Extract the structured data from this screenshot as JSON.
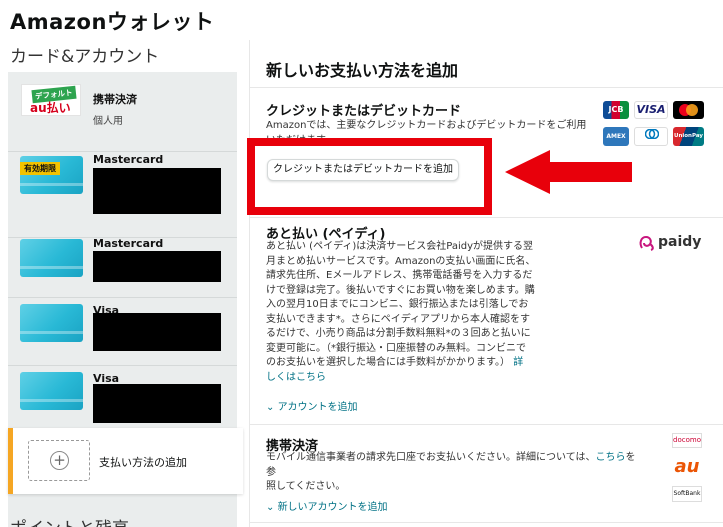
{
  "header": {
    "title": "Amazonウォレット",
    "section": "カード&アカウント",
    "bottom": "ポイントと残高"
  },
  "left": {
    "items": [
      {
        "name": "携帯決済",
        "sub": "個人用",
        "tag": "デフォルト",
        "logo": "au払い"
      },
      {
        "name": "Mastercard",
        "badge": "有効期限"
      },
      {
        "name": "Mastercard"
      },
      {
        "name": "Visa"
      },
      {
        "name": "Visa"
      }
    ],
    "add_label": "支払い方法の追加"
  },
  "panel": {
    "title": "新しいお支払い方法を追加",
    "credit": {
      "heading": "クレジットまたはデビットカード",
      "desc": "Amazonでは、主要なクレジットカードおよびデビットカードをご利用いただけます。",
      "button": "クレジットまたはデビットカードを追加",
      "logos": [
        "JCB",
        "VISA",
        "Mastercard",
        "AMEX",
        "Diners Club",
        "UnionPay"
      ]
    },
    "paidy": {
      "heading": "あと払い (ペイディ)",
      "logo": "paidy",
      "desc_lines": [
        "あと払い (ペイディ)は決済サービス会社Paidyが提供する翌",
        "月まとめ払いサービスです。Amazonの支払い画面に氏名、",
        "請求先住所、Eメールアドレス、携帯電話番号を入力するだ",
        "けで登録は完了。後払いですぐにお買い物を楽しめます。購",
        "入の翌月10日までにコンビニ、銀行振込または引落しでお",
        "支払いできます*。さらにペイディアプリから本人確認をす",
        "るだけで、小売り商品は分割手数料無料*の３回あと払いに",
        "変更可能に。（*銀行振込・口座振替のみ無料。コンビニで",
        "のお支払いを選択した場合には手数料がかかります。）"
      ],
      "detail_link": "詳",
      "detail_link2": "しくはこちら",
      "expand": "アカウントを追加"
    },
    "carrier": {
      "heading": "携帯決済",
      "desc1": "モバイル通信事業者の請求先口座でお支払いください。詳細については、",
      "link": "こちら",
      "desc2": "を参",
      "desc3": "照してください。",
      "expand": "新しいアカウントを追加",
      "logos": [
        "docomo",
        "au",
        "SoftBank"
      ]
    }
  },
  "colors": {
    "link": "#007185",
    "highlight": "#e8000b",
    "accent": "#f5a623"
  }
}
